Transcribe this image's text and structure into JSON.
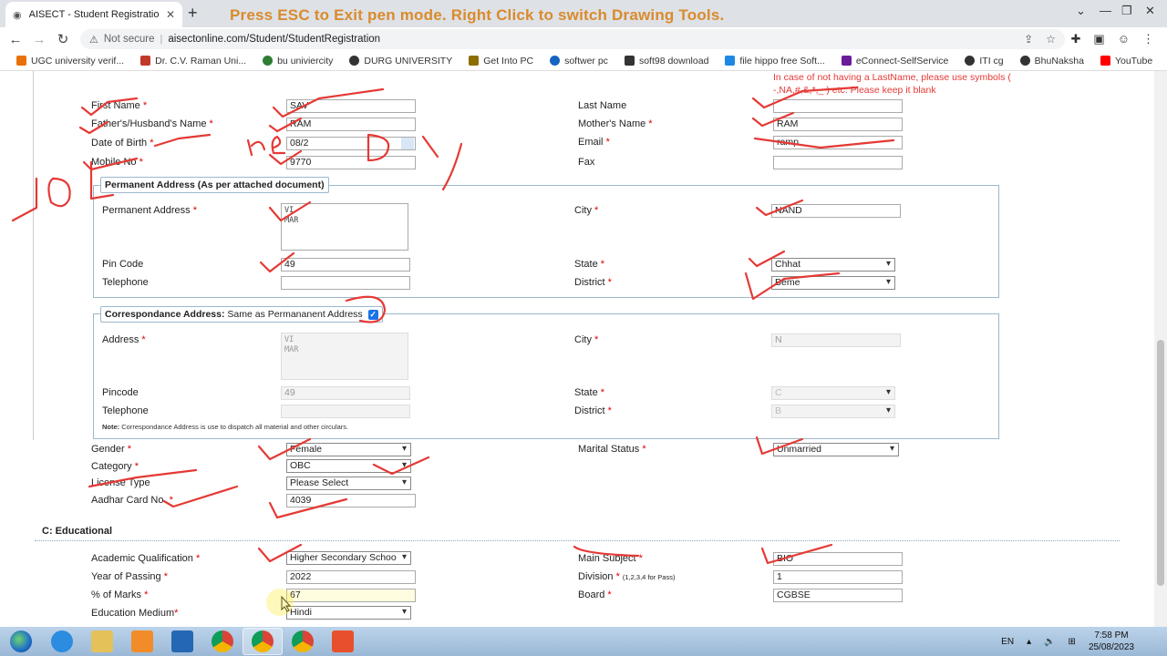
{
  "browser": {
    "tab_title": "AISECT - Student Registration",
    "tab_close": "✕",
    "new_tab": "+",
    "pen_banner": "Press ESC to Exit pen mode.  Right Click to switch Drawing Tools.",
    "security": "Not secure",
    "url": "aisectonline.com/Student/StudentRegistration"
  },
  "bookmarks": [
    {
      "label": "UGC university verif...",
      "color": "#e8710a"
    },
    {
      "label": "Dr. C.V. Raman Uni...",
      "color": "#c0392b"
    },
    {
      "label": "bu univiercity",
      "color": "#2e7d32"
    },
    {
      "label": "DURG UNIVERSITY",
      "color": "#333333"
    },
    {
      "label": "Get Into PC",
      "color": "#8d6e00"
    },
    {
      "label": "softwer pc",
      "color": "#1565c0"
    },
    {
      "label": "soft98 download",
      "color": "#333333"
    },
    {
      "label": "file hippo free Soft...",
      "color": "#1e88e5"
    },
    {
      "label": "eConnect-SelfService",
      "color": "#6a1b9a"
    },
    {
      "label": "ITI cg",
      "color": "#333333"
    },
    {
      "label": "BhuNaksha",
      "color": "#333333"
    },
    {
      "label": "YouTube",
      "color": "#ff0000"
    }
  ],
  "form": {
    "notice": "In case of not having a LastName, please use symbols ( -,NA,#,&,*,_ ) etc. Please keep it blank",
    "first_name_label": "First Name",
    "first_name_value": "SAV",
    "last_name_label": "Last Name",
    "last_name_value": "",
    "father_label": "Father's/Husband's Name",
    "father_value": "RAM",
    "mother_label": "Mother's Name",
    "mother_value": "RAM",
    "dob_label": "Date of Birth",
    "dob_value": "08/2",
    "email_label": "Email",
    "email_value": "ramp",
    "mobile_label": "Mobile No",
    "mobile_value": "9770",
    "fax_label": "Fax",
    "fax_value": "",
    "perm_legend": "Permanent Address (As per attached document)",
    "perm_address_label": "Permanent Address",
    "perm_address_value": "VI\nMAR",
    "city_label": "City",
    "city_value": "NAND",
    "pin_label": "Pin Code",
    "pin_value": "49",
    "state_label": "State",
    "state_value": "Chhat",
    "telephone_label": "Telephone",
    "telephone_value": "",
    "district_label": "District",
    "district_value": "Beme",
    "corr_legend_bold": "Correspondance Address:",
    "corr_legend_normal": "Same as Permananent Address",
    "corr_checked": "✓",
    "corr_address_label": "Address",
    "corr_address_value": "VI\nMAR",
    "corr_city_label": "City",
    "corr_city_value": "N",
    "corr_pin_label": "Pincode",
    "corr_pin_value": "49",
    "corr_state_label": "State",
    "corr_state_value": "C",
    "corr_tel_label": "Telephone",
    "corr_district_label": "District",
    "corr_district_value": "B",
    "corr_note_bold": "Note:",
    "corr_note": "Correspondance Address is use to dispatch all material and other circulars.",
    "gender_label": "Gender",
    "gender_value": "Female",
    "marital_label": "Marital Status",
    "marital_value": "Unmarried",
    "category_label": "Category",
    "category_value": "OBC",
    "license_label": "License Type",
    "license_value": "Please Select",
    "aadhar_label": "Aadhar Card No.",
    "aadhar_value": "4039",
    "edu_section": "C: Educational",
    "qual_label": "Academic Qualification",
    "qual_value": "Higher Secondary Schoo",
    "subject_label": "Main Subject",
    "subject_value": "BIO",
    "year_label": "Year of Passing",
    "year_value": "2022",
    "division_label": "Division",
    "division_hint": "(1,2,3,4 for Pass)",
    "division_value": "1",
    "marks_label": "% of Marks",
    "marks_value": "67",
    "board_label": "Board",
    "board_value": "CGBSE",
    "medium_label": "Education Medium",
    "medium_value": "Hindi",
    "req": "*"
  },
  "annotation": {
    "scrawl_1": "1OL",
    "scrawl_2": "ne",
    "scrawl_3": "D",
    "scrawl_4": "y",
    "ink_color": "#e53935"
  },
  "taskbar": {
    "lang": "EN",
    "time": "7:58 PM",
    "date": "25/08/2023"
  }
}
